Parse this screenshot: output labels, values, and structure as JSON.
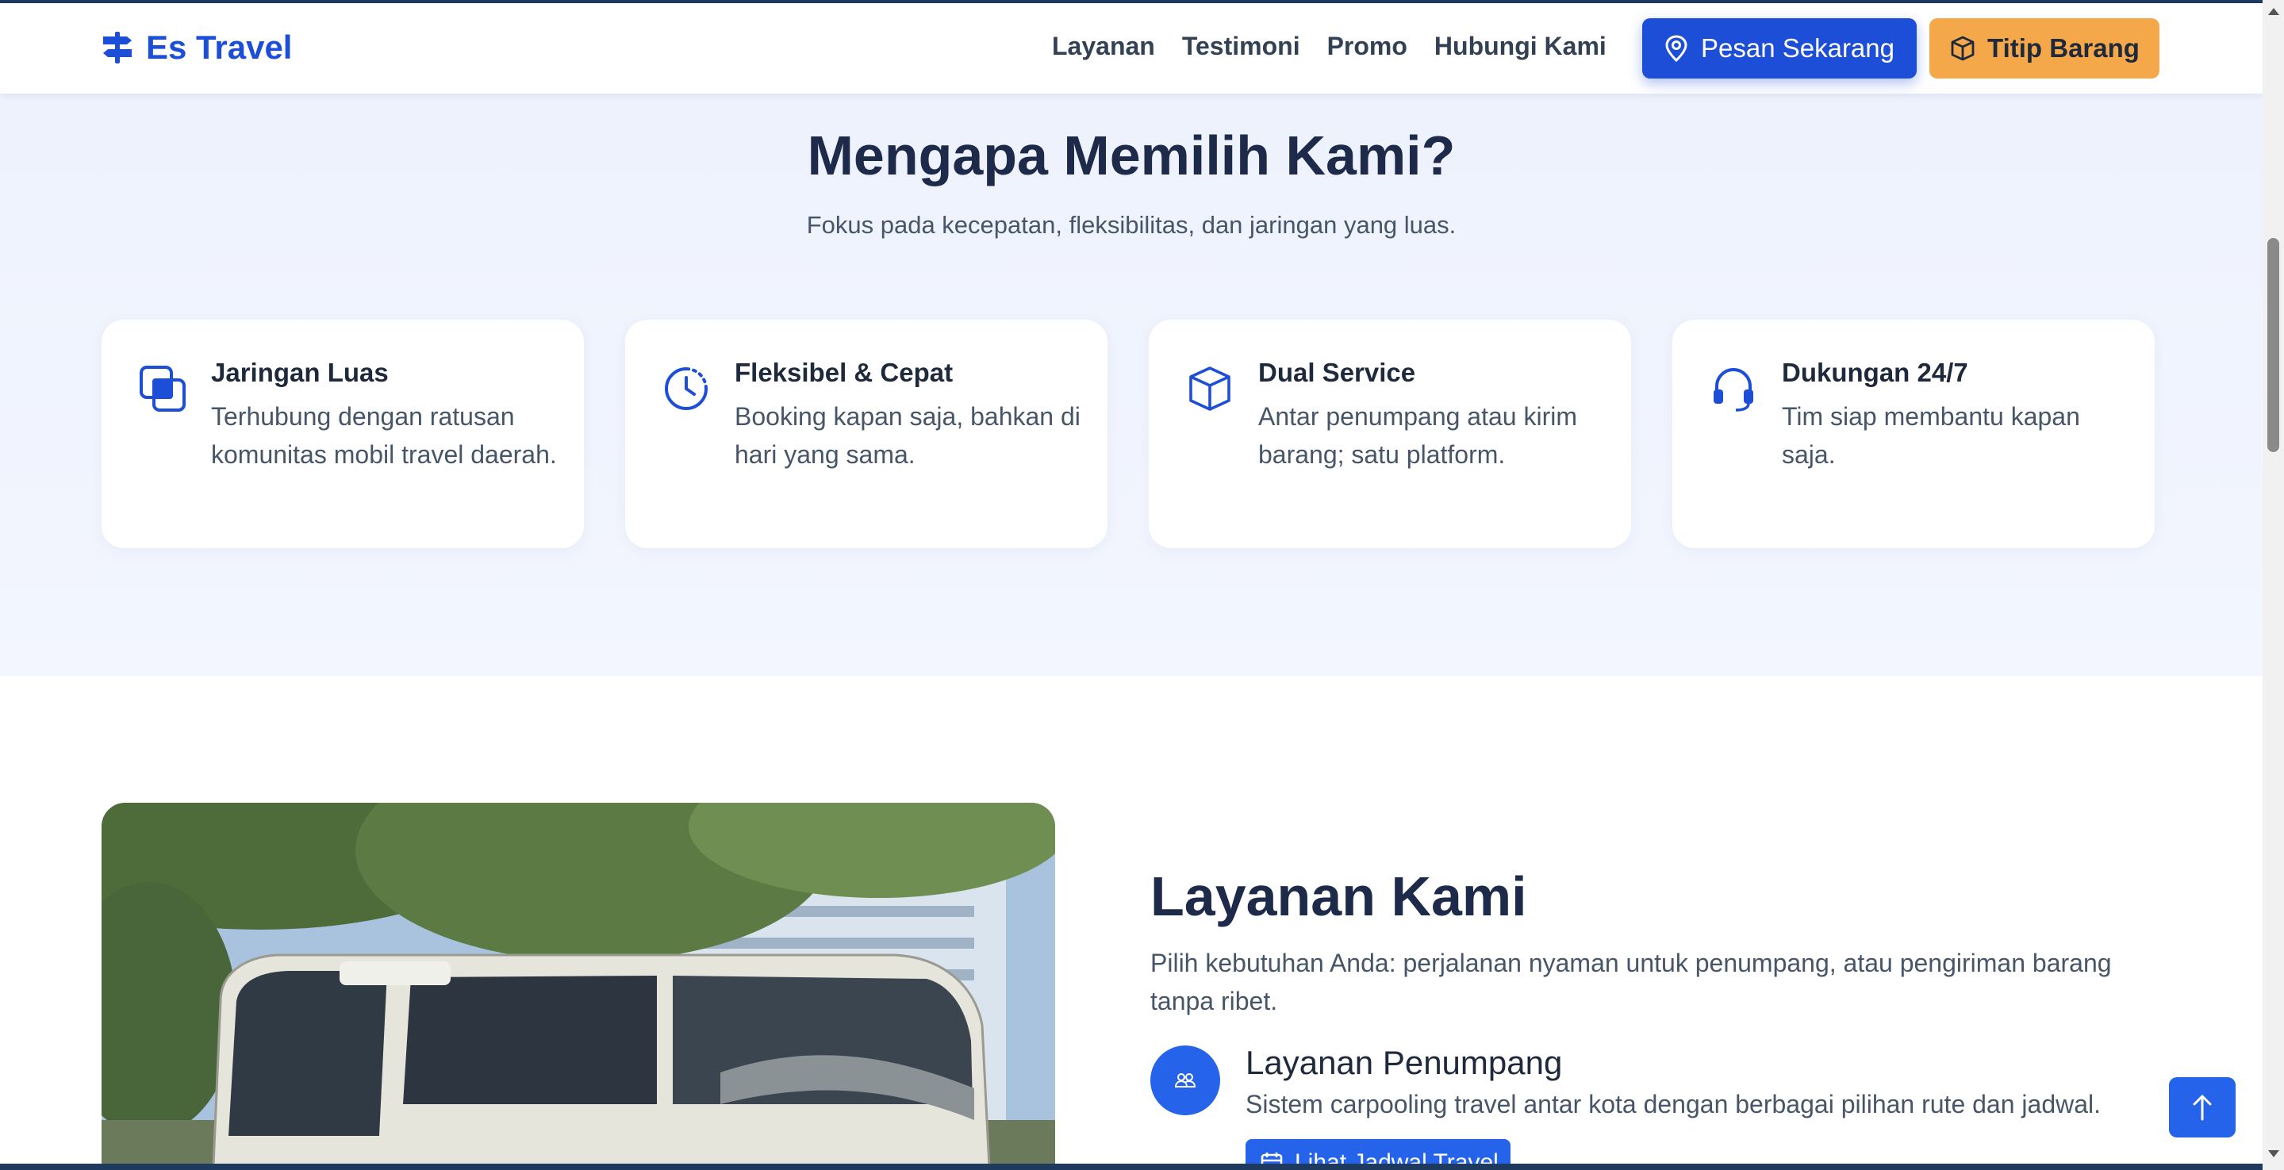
{
  "brand": {
    "name": "Es Travel",
    "icon": "signpost-icon"
  },
  "nav": {
    "links": [
      "Layanan",
      "Testimoni",
      "Promo",
      "Hubungi Kami"
    ],
    "cta_primary": "Pesan Sekarang",
    "cta_secondary": "Titip Barang"
  },
  "why": {
    "title": "Mengapa Memilih Kami?",
    "subtitle": "Fokus pada kecepatan, fleksibilitas, dan jaringan yang luas.",
    "cards": [
      {
        "icon": "network-layers-icon",
        "title": "Jaringan Luas",
        "text": "Terhubung dengan ratusan komunitas mobil travel daerah."
      },
      {
        "icon": "clock-icon",
        "title": "Fleksibel & Cepat",
        "text": "Booking kapan saja, bahkan di hari yang sama."
      },
      {
        "icon": "box-icon",
        "title": "Dual Service",
        "text": "Antar penumpang atau kirim barang; satu platform."
      },
      {
        "icon": "headset-icon",
        "title": "Dukungan 24/7",
        "text": "Tim siap membantu kapan saja."
      }
    ]
  },
  "services": {
    "title": "Layanan Kami",
    "description": "Pilih kebutuhan Anda: perjalanan nyaman untuk penumpang, atau pengiriman barang tanpa ribet.",
    "item": {
      "title": "Layanan Penumpang",
      "text": "Sistem carpooling travel antar kota dengan berbagai pilihan rute dan jadwal.",
      "button": "Lihat Jadwal Travel"
    }
  },
  "colors": {
    "primary": "#1d4ed8",
    "accent": "#f4a84a",
    "heading": "#1e2a4a"
  }
}
